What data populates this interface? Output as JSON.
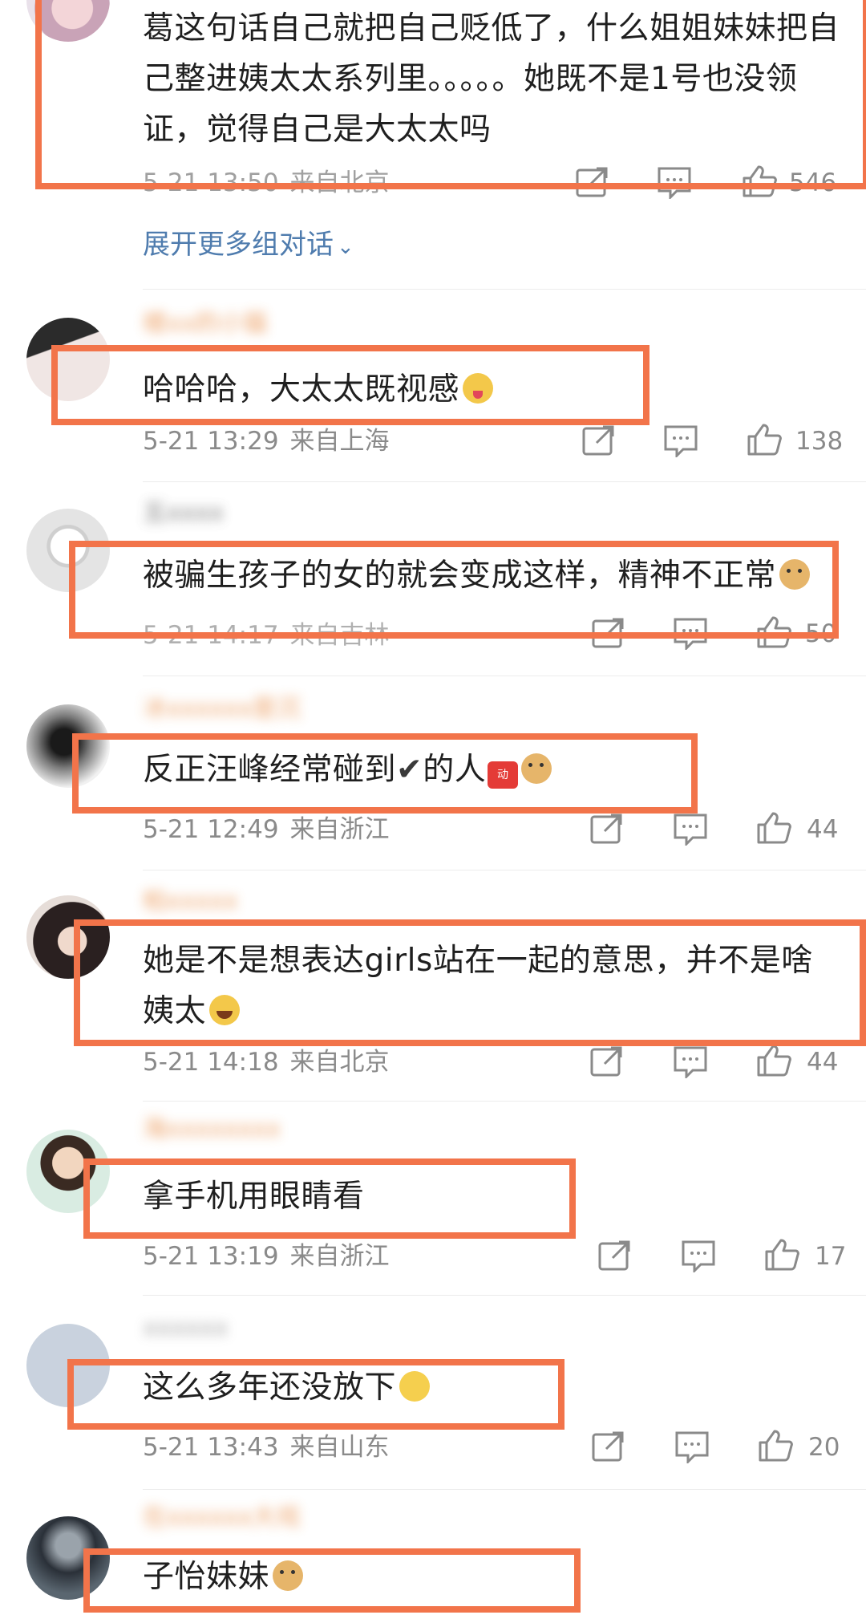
{
  "expand_link": "展开更多组对话",
  "comments": [
    {
      "text": "葛这句话自己就把自己贬低了，什么姐姐妹妹把自己整进姨太太系列里。。。。。她既不是1号也没领证，觉得自己是大太太吗",
      "time": "5-21 13:50",
      "location": "来自北京",
      "likes": "546"
    },
    {
      "username": "楼xx的小猫",
      "text": "哈哈哈，大太太既视感",
      "emoji": "tongue-emoji",
      "time": "5-21 13:29",
      "location": "来自上海",
      "likes": "138"
    },
    {
      "username": "五xxxx",
      "text": "被骗生孩子的女的就会变成这样，精神不正常",
      "emoji": "doge-emoji",
      "time": "5-21 14:17",
      "location": "来自吉林",
      "likes": "50"
    },
    {
      "username": "冰xxxxxx是沉",
      "text": "反正汪峰经常碰到",
      "check": "✔",
      "text2": "的人",
      "badge": "动",
      "emoji": "doge-emoji",
      "time": "5-21 12:49",
      "location": "来自浙江",
      "likes": "44"
    },
    {
      "username": "柏xxxxx",
      "text": "她是不是想表达girls站在一起的意思，并不是啥姨太",
      "emoji": "laugh-emoji",
      "time": "5-21 14:18",
      "location": "来自北京",
      "likes": "44"
    },
    {
      "username": "海xxxxxxxx",
      "text": "拿手机用眼睛看",
      "time": "5-21 13:19",
      "location": "来自浙江",
      "likes": "17"
    },
    {
      "username": "xxxxxx",
      "text": "这么多年还没放下",
      "emoji": "shrug-emoji",
      "time": "5-21 13:43",
      "location": "来自山东",
      "likes": "20"
    },
    {
      "username": "在xxxxxx大戏",
      "text": "子怡妹妹",
      "emoji": "doge-emoji"
    }
  ],
  "colors": {
    "highlight": "#f2744a",
    "link": "#4f7cae",
    "meta": "#8a8a8a",
    "text": "#1f1f1f"
  },
  "icons": [
    "share-icon",
    "comment-icon",
    "like-icon"
  ]
}
